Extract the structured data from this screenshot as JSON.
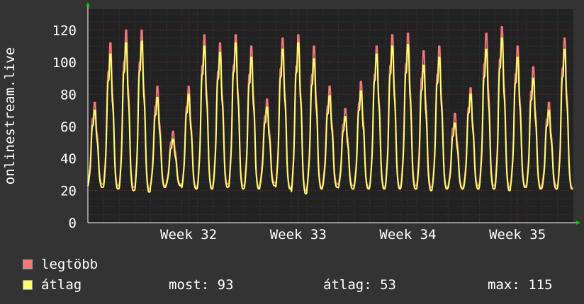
{
  "colors": {
    "background": "#333333",
    "plot_background": "#222222",
    "grid_major": "#7a2a2a",
    "grid_minor": "#3a3a3a",
    "axis": "#ffffff",
    "legtobb": "#f07878",
    "atlag": "#ffff70",
    "arrow": "#00cc00"
  },
  "chart_data": {
    "type": "line",
    "ylabel": "onlinestream.live",
    "xlabel": "",
    "title": "",
    "ylim": [
      0,
      133
    ],
    "yticks": [
      0,
      20,
      40,
      60,
      80,
      100,
      120
    ],
    "y_minor_step": 5,
    "grid": true,
    "x_unit": "day",
    "xlim": [
      0,
      31
    ],
    "xtick_positions": [
      6.43,
      13.43,
      20.43,
      27.43
    ],
    "xtick_labels": [
      "Week 32",
      "Week 33",
      "Week 34",
      "Week 35"
    ],
    "legend_placement": "bottom-left",
    "daily_peaks": {
      "legtobb": [
        75,
        112,
        120,
        120,
        85,
        57,
        85,
        117,
        112,
        117,
        110,
        77,
        115,
        117,
        110,
        85,
        71,
        88,
        110,
        117,
        118,
        107,
        110,
        68,
        84,
        118,
        122,
        110,
        97,
        75,
        115
      ],
      "atlag": [
        70,
        105,
        112,
        113,
        78,
        52,
        80,
        110,
        106,
        112,
        103,
        72,
        108,
        112,
        102,
        79,
        66,
        82,
        105,
        110,
        111,
        98,
        103,
        62,
        80,
        108,
        115,
        103,
        90,
        70,
        108
      ]
    },
    "daily_troughs": {
      "legtobb": [
        24,
        23,
        22,
        21,
        23,
        24,
        22,
        22,
        24,
        23,
        22,
        25,
        22,
        20,
        22,
        24,
        23,
        22,
        22,
        22,
        23,
        22,
        22,
        22,
        23,
        23,
        22,
        23,
        22,
        23,
        22
      ],
      "atlag": [
        22,
        21,
        20,
        19,
        22,
        23,
        21,
        21,
        22,
        21,
        21,
        23,
        21,
        18,
        21,
        22,
        21,
        21,
        21,
        21,
        21,
        20,
        21,
        21,
        21,
        21,
        20,
        22,
        21,
        21,
        21
      ]
    },
    "series": [
      {
        "name": "legtöbb",
        "color": "#f07878"
      },
      {
        "name": "átlag",
        "color": "#ffff70"
      }
    ]
  },
  "legend": {
    "items": [
      {
        "label": "legtöbb",
        "color": "#f07878"
      },
      {
        "label": "átlag",
        "color": "#ffff70"
      }
    ]
  },
  "stats": {
    "current": "most: 93",
    "average": "átlag: 53",
    "maximum": "max: 115"
  }
}
